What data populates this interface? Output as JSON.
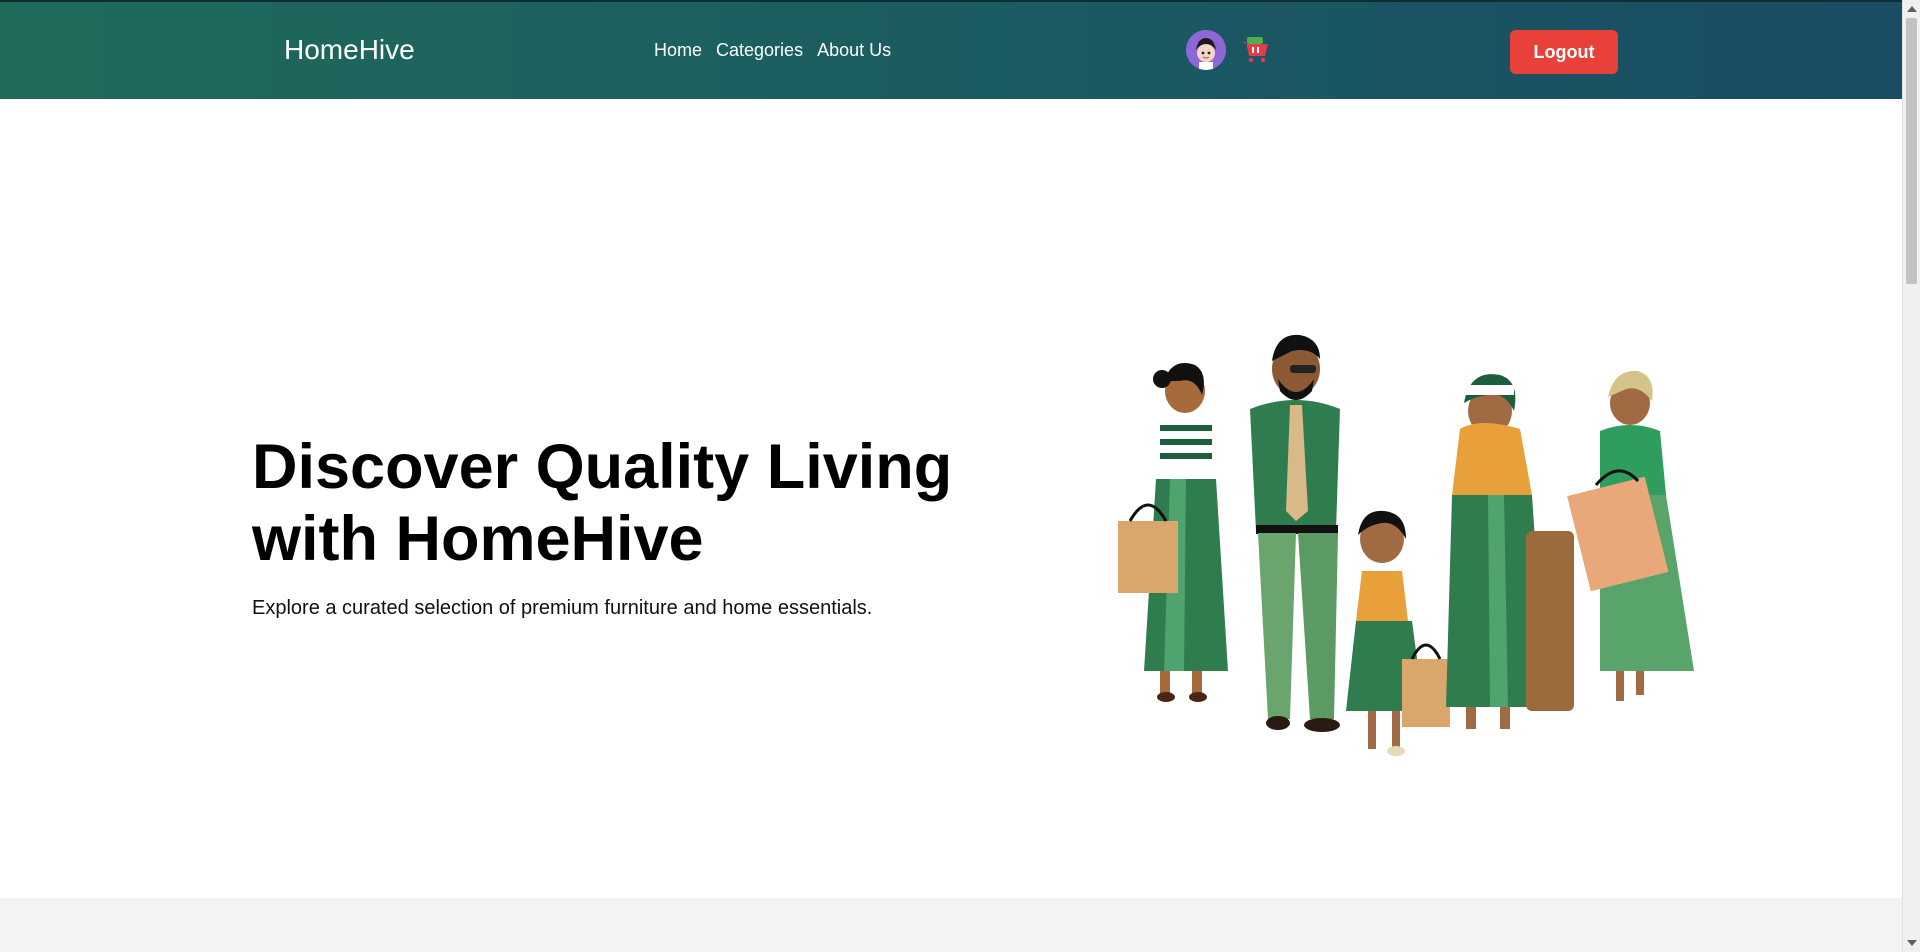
{
  "header": {
    "brand": "HomeHive",
    "nav": [
      "Home",
      "Categories",
      "About Us"
    ],
    "logout_label": "Logout",
    "accent_color": "#e8413a",
    "gradient_colors": [
      "#1f6b5a",
      "#1a4c63"
    ]
  },
  "hero": {
    "title": "Discover Quality Living with HomeHive",
    "subtitle": "Explore a curated selection of premium furniture and home essentials."
  },
  "icons": {
    "avatar": "user-avatar-icon",
    "cart": "shopping-cart-icon",
    "illustration": "family-shopping-illustration"
  }
}
